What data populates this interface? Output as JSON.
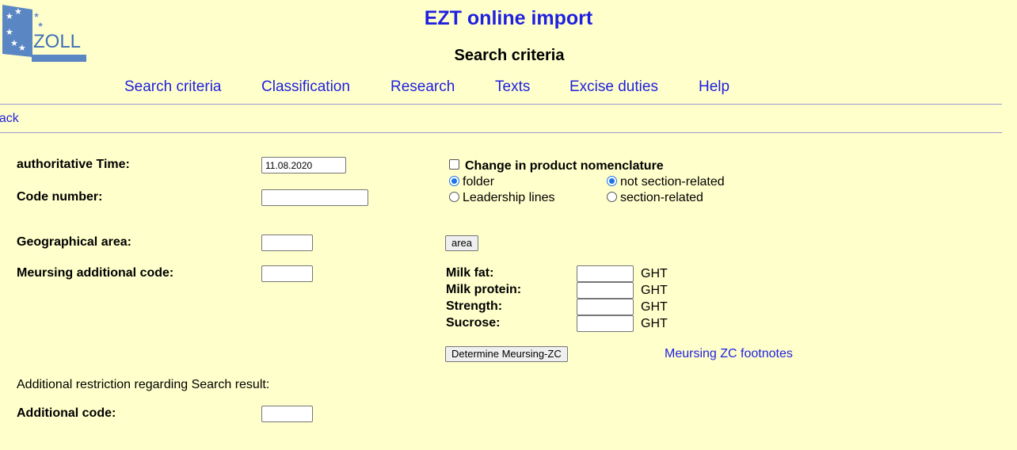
{
  "app": {
    "title": "EZT online import",
    "page_title": "Search criteria",
    "logo_text": "ZOLL"
  },
  "nav": {
    "items": [
      {
        "label": "Search criteria"
      },
      {
        "label": "Classification"
      },
      {
        "label": "Research"
      },
      {
        "label": "Texts"
      },
      {
        "label": "Excise duties"
      },
      {
        "label": "Help"
      }
    ],
    "back_label": "back"
  },
  "form": {
    "authoritative_time": {
      "label": "authoritative Time:",
      "value": "11.08.2020"
    },
    "code_number": {
      "label": "Code number:",
      "value": ""
    },
    "geographical_area": {
      "label": "Geographical area:",
      "value": "",
      "button": "area"
    },
    "meursing_code": {
      "label": "Meursing additional code:",
      "value": ""
    },
    "nomenclature": {
      "checkbox_label": "Change in product nomenclature",
      "checked": false,
      "radio_folder": "folder",
      "radio_leadership": "Leadership lines",
      "radio_not_section": "not section-related",
      "radio_section": "section-related",
      "selected_view": "folder",
      "selected_section": "not section-related"
    },
    "meursing": {
      "milk_fat": {
        "label": "Milk fat:",
        "value": "",
        "unit": "GHT"
      },
      "milk_protein": {
        "label": "Milk protein:",
        "value": "",
        "unit": "GHT"
      },
      "strength": {
        "label": "Strength:",
        "value": "",
        "unit": "GHT"
      },
      "sucrose": {
        "label": "Sucrose:",
        "value": "",
        "unit": "GHT"
      },
      "determine_button": "Determine Meursing-ZC",
      "footnotes_link": "Meursing ZC footnotes"
    },
    "restriction_text": "Additional restriction regarding Search result:",
    "additional_code": {
      "label": "Additional code:",
      "value": ""
    }
  },
  "colors": {
    "background": "#ffffcc",
    "link": "#1f1fe0",
    "logo_blue": "#3f6fb5"
  }
}
